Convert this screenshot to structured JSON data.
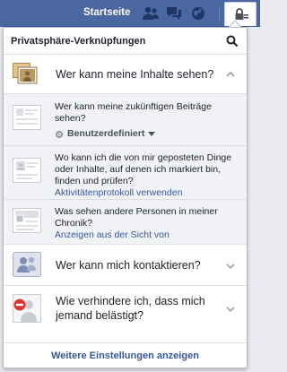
{
  "topbar": {
    "home_label": "Startseite",
    "icons": [
      "friends-icon",
      "messages-icon",
      "globe-icon",
      "privacy-lock-icon"
    ]
  },
  "panel": {
    "title": "Privatsphäre-Verknüpfungen",
    "sections": [
      {
        "label": "Wer kann meine Inhalte sehen?",
        "expanded": true,
        "items": [
          {
            "text": "Wer kann meine zukünftigen Beiträge sehen?",
            "control_label": "Benutzerdefiniert"
          },
          {
            "text": "Wo kann ich die von mir geposteten Dinge oder Inhalte, auf denen ich markiert bin, finden und prüfen?",
            "link": "Aktivitätenprotokoll verwenden"
          },
          {
            "text": "Was sehen andere Personen in meiner Chronik?",
            "link": "Anzeigen aus der Sicht von"
          }
        ]
      },
      {
        "label": "Wer kann mich kontaktieren?",
        "expanded": false
      },
      {
        "label": "Wie verhindere ich, dass mich jemand belästigt?",
        "expanded": false
      }
    ],
    "footer_link": "Weitere Einstellungen anzeigen"
  },
  "colors": {
    "topbar": "#4b67a1",
    "link": "#365899",
    "sub_bg": "#f0f2f5",
    "block_red": "#d8372e"
  }
}
